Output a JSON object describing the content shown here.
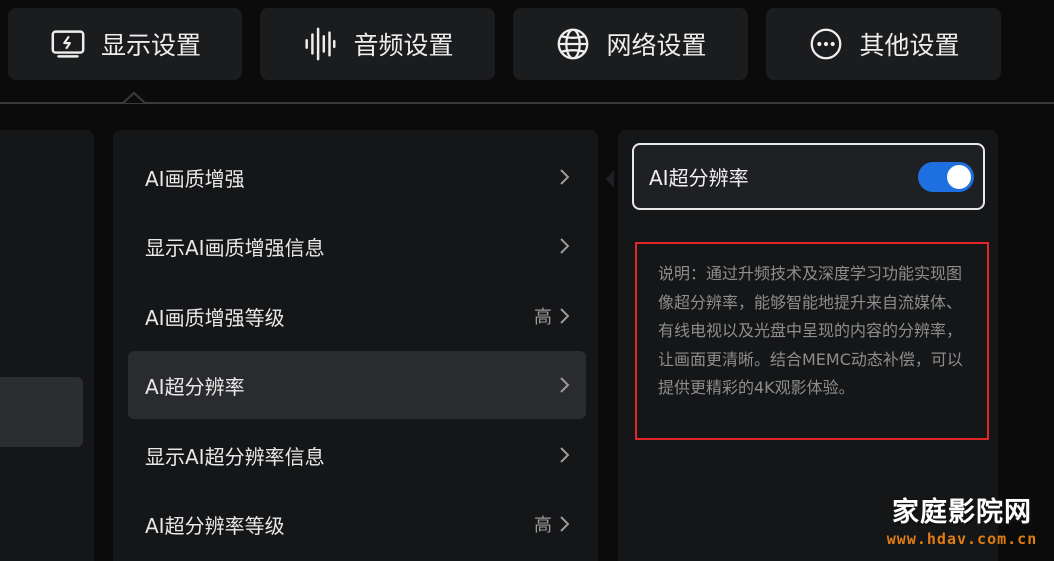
{
  "tabs": [
    {
      "label": "显示设置",
      "icon": "display-icon"
    },
    {
      "label": "音频设置",
      "icon": "audio-waveform-icon"
    },
    {
      "label": "网络设置",
      "icon": "globe-icon"
    },
    {
      "label": "其他设置",
      "icon": "more-dots-icon"
    }
  ],
  "menu": {
    "items": [
      {
        "label": "AI画质增强",
        "value": ""
      },
      {
        "label": "显示AI画质增强信息",
        "value": ""
      },
      {
        "label": "AI画质增强等级",
        "value": "高"
      },
      {
        "label": "AI超分辨率",
        "value": "",
        "active": true
      },
      {
        "label": "显示AI超分辨率信息",
        "value": ""
      },
      {
        "label": "AI超分辨率等级",
        "value": "高"
      }
    ]
  },
  "detail": {
    "toggle_label": "AI超分辨率",
    "toggle_on": true,
    "description": "说明：通过升频技术及深度学习功能实现图像超分辨率，能够智能地提升来自流媒体、有线电视以及光盘中呈现的内容的分辨率，让画面更清晰。结合MEMC动态补偿，可以提供更精彩的4K观影体验。"
  },
  "watermark": {
    "title": "家庭影院网",
    "url": "www.hdav.com.cn"
  },
  "colors": {
    "toggle_on": "#1e6fe0",
    "highlight_border": "#e0262a",
    "watermark_url": "#e07d12"
  }
}
